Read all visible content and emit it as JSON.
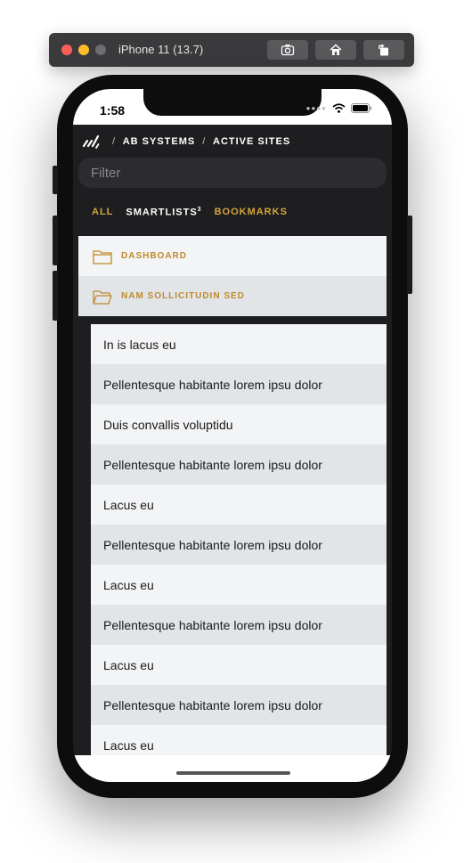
{
  "simulator": {
    "title": "iPhone 11 (13.7)",
    "buttons": [
      "screenshot-icon",
      "home-icon",
      "rotate-icon"
    ]
  },
  "status": {
    "time": "1:58"
  },
  "breadcrumb": {
    "items": [
      "AB SYSTEMS",
      "ACTIVE SITES"
    ],
    "separator": "/"
  },
  "filter": {
    "placeholder": "Filter",
    "value": ""
  },
  "tabs": {
    "all": "ALL",
    "smartlists": "SMARTLISTS",
    "smartlists_count": "3",
    "bookmarks": "BOOKMARKS"
  },
  "folders": [
    {
      "label": "DASHBOARD",
      "icon": "folder-icon"
    },
    {
      "label": "NAM SOLLICITUDIN SED",
      "icon": "folder-open-icon"
    }
  ],
  "list": [
    "In is lacus eu",
    "Pellentesque habitante lorem ipsu dolor",
    "Duis convallis voluptidu",
    "Pellentesque habitante lorem ipsu dolor",
    "Lacus eu",
    "Pellentesque habitante lorem ipsu dolor",
    "Lacus eu",
    "Pellentesque habitante lorem ipsu dolor",
    "Lacus eu",
    "Pellentesque habitante lorem ipsu dolor",
    "Lacus eu"
  ],
  "colors": {
    "accent_gold": "#d4a63a",
    "screen_background": "#1e1e20",
    "row_light": "#f3f4f6",
    "row_dark": "#e1e5e8"
  }
}
